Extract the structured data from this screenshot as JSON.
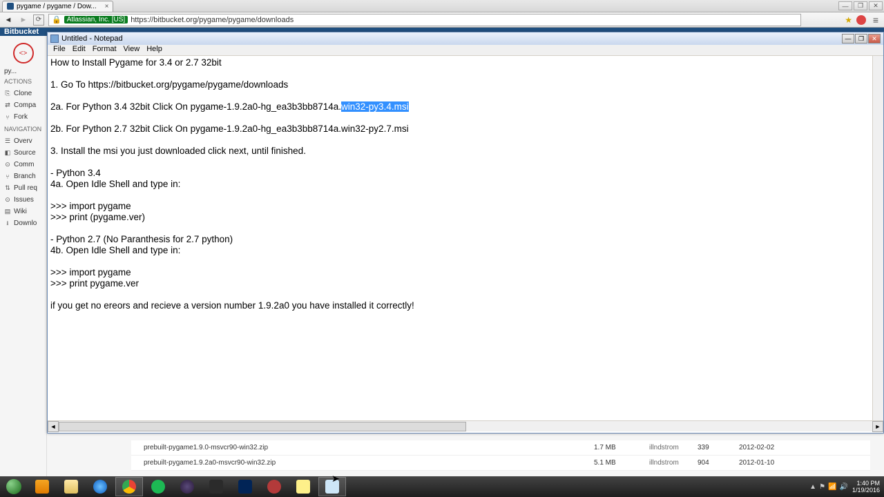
{
  "browser": {
    "tab_title": "pygame / pygame / Dow...",
    "url_host": "Atlassian, Inc. [US]",
    "url_path": "https://bitbucket.org/pygame/pygame/downloads"
  },
  "bitbucket": {
    "logo": "Bitbucket",
    "repo_name": "py...",
    "section_actions": "Actions",
    "clone": "Clone",
    "compare": "Compa",
    "fork": "Fork",
    "section_nav": "Navigation",
    "overview": "Overv",
    "source": "Source",
    "commits": "Comm",
    "branches": "Branch",
    "pullreq": "Pull req",
    "issues": "Issues",
    "wiki": "Wiki",
    "downloads": "Downlo"
  },
  "table": {
    "rows": [
      {
        "name": "prebuilt-pygame1.9.0-msvcr90-win32.zip",
        "size": "1.7 MB",
        "user": "illndstrom",
        "count": "339",
        "date": "2012-02-02"
      },
      {
        "name": "prebuilt-pygame1.9.2a0-msvcr90-win32.zip",
        "size": "5.1 MB",
        "user": "illndstrom",
        "count": "904",
        "date": "2012-01-10"
      }
    ]
  },
  "notepad": {
    "title": "Untitled - Notepad",
    "menu": {
      "file": "File",
      "edit": "Edit",
      "format": "Format",
      "view": "View",
      "help": "Help"
    },
    "content": {
      "l1": "How to Install Pygame for 3.4 or 2.7 32bit",
      "l2": "",
      "l3": "1. Go To https://bitbucket.org/pygame/pygame/downloads",
      "l4": "",
      "l5a": "2a. For Python 3.4 32bit Click On pygame-1.9.2a0-hg_ea3b3bb8714a.",
      "l5b": "win32-py3.4.msi",
      "l6": "",
      "l7": "2b. For Python 2.7 32bit Click On pygame-1.9.2a0-hg_ea3b3bb8714a.win32-py2.7.msi",
      "l8": "",
      "l9": "3. Install the msi you just downloaded click next, until finished.",
      "l10": "",
      "l11": "- Python 3.4",
      "l12": "4a. Open Idle Shell and type in:",
      "l13": "",
      "l14": ">>> import pygame",
      "l15": ">>> print (pygame.ver)",
      "l16": "",
      "l17": "- Python 2.7 (No Paranthesis for 2.7 python)",
      "l18": "4b. Open Idle Shell and type in:",
      "l19": "",
      "l20": ">>> import pygame",
      "l21": ">>> print pygame.ver",
      "l22": "",
      "l23": "if you get no ereors and recieve a version number 1.9.2a0 you have installed it correctly!"
    }
  },
  "tray": {
    "time": "1:40 PM",
    "date": "1/19/2016"
  }
}
